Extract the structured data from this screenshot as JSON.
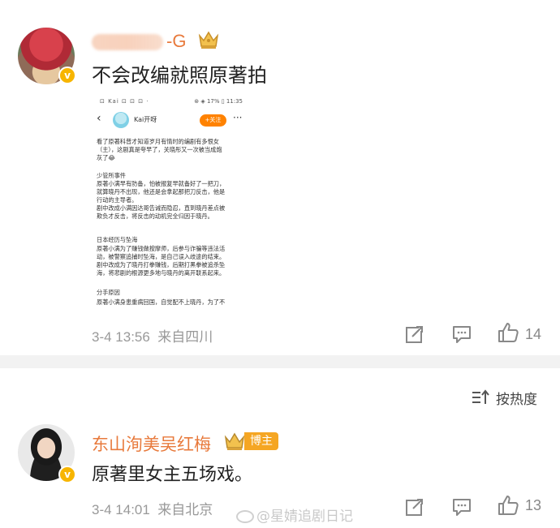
{
  "comment1": {
    "username_visible": "-G",
    "text": "不会改编就照原著拍",
    "timestamp": "3-4 13:56",
    "location": "来自四川",
    "like_count": "14",
    "embedded_screenshot": {
      "status_left": "⊡ Kai ⊡ ⊡ ⊡ ·",
      "status_right": "⊛ ◈ 17% ▯ 11:35",
      "author": "Kai开呀",
      "follow_label": "+关注",
      "lines": [
        "看了原著科普才知道岁月有情时的编剧有多恨女",
        "（主），这剧真是夸早了，关晓彤又一次被当成炮",
        "灰了😂",
        "",
        "少管所事件",
        "原著小满早有防备，怕被报复早就备好了一把刀，",
        "就算晓丹不出现，他还是会拿起那把刀反击，他是",
        "行动的主导者。",
        "剧中改成小满因达哥告诫而隐忍，直到晓丹差点被",
        "欺负才反击，将反击的动机完全归因于晓丹。",
        "",
        "日本经历与坠海",
        "原著小满为了赚钱做按摩师，后参与诈骗等违法活",
        "动，被警察追捕时坠海，是自己误入歧途的结束。",
        "剧中改成为了晓丹打拳赚钱，后期打黑拳被追杀坠",
        "海，将悲剧的根源更多地与晓丹的离开联系起来。",
        "",
        "分手原因",
        "原著小满身患重病回国，自觉配不上晓丹，为了不"
      ]
    }
  },
  "sort": {
    "label": "按热度"
  },
  "comment2": {
    "username": "东山洵美吴红梅",
    "badge": "博主",
    "text": "原著里女主五场戏。",
    "timestamp": "3-4 14:01",
    "location": "来自北京",
    "watermark": "@星婧追剧日记",
    "like_count": "13"
  },
  "colors": {
    "username": "#e87a3c",
    "badge": "#f5a623",
    "verified": "#f7b500",
    "follow": "#ff8200",
    "separator": "#f2f2f2"
  }
}
